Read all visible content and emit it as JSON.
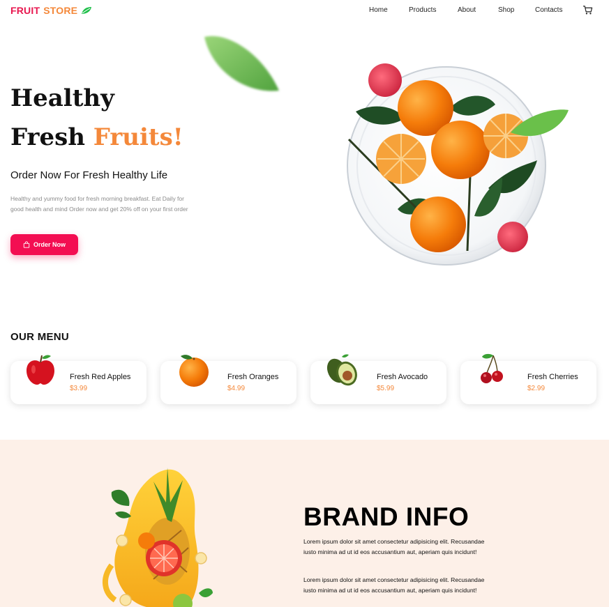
{
  "navbar": {
    "logo_word1": "FRUIT",
    "logo_word2": "STORE",
    "links": [
      "Home",
      "Products",
      "About",
      "Shop",
      "Contacts"
    ],
    "cart_icon": "cart-icon"
  },
  "hero": {
    "line1": "Healthy",
    "line2_plain": "Fresh",
    "line2_accent": "Fruits!",
    "subtitle": "Order Now For Fresh Healthy Life",
    "description": "Healthy and yummy food for fresh morning breakfast. Eat Daily for good health and mind Order now and get 20% off on your first order",
    "order_button": "Order Now",
    "order_icon": "shopping-bag-icon"
  },
  "menu": {
    "title": "OUR MENU",
    "items": [
      {
        "name": "Fresh Red Apples",
        "price": "$3.99",
        "icon": "apple-icon"
      },
      {
        "name": "Fresh Oranges",
        "price": "$4.99",
        "icon": "orange-icon"
      },
      {
        "name": "Fresh Avocado",
        "price": "$5.99",
        "icon": "avocado-icon"
      },
      {
        "name": "Fresh Cherries",
        "price": "$2.99",
        "icon": "cherries-icon"
      }
    ]
  },
  "brand": {
    "title": "BRAND INFO",
    "paragraph1": "Lorem ipsum dolor sit amet consectetur adipisicing elit. Recusandae iusto minima ad ut id eos accusantium aut, aperiam quis incidunt!",
    "paragraph2": "Lorem ipsum dolor sit amet consectetur adipisicing elit. Recusandae iusto minima ad ut id eos accusantium aut, aperiam quis incidunt!"
  },
  "colors": {
    "brand_pink": "#e8174f",
    "brand_orange": "#f4883a",
    "button": "#f30e52",
    "brand_section_bg": "#fdf0e8",
    "price": "#f4883a"
  }
}
